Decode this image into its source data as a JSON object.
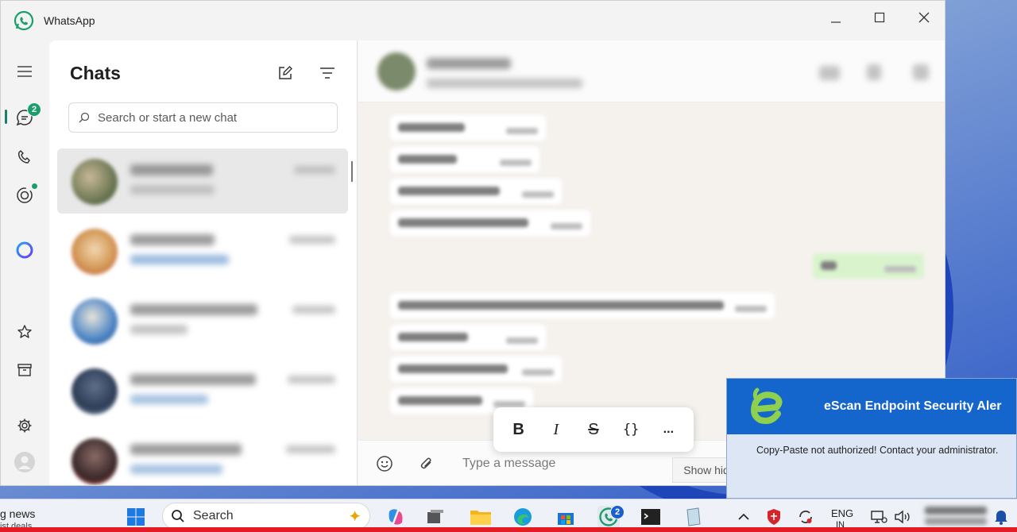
{
  "window": {
    "title": "WhatsApp",
    "controls": [
      "minimize-icon",
      "maximize-icon",
      "close-icon"
    ]
  },
  "rail": {
    "items": [
      {
        "name": "menu",
        "icon": "hamburger-icon"
      },
      {
        "name": "chats",
        "icon": "chat-icon",
        "badge": "2"
      },
      {
        "name": "calls",
        "icon": "phone-icon"
      },
      {
        "name": "status",
        "icon": "status-icon"
      },
      {
        "name": "meta-ai",
        "icon": "meta-ai-icon"
      },
      {
        "name": "starred",
        "icon": "star-icon"
      },
      {
        "name": "archived",
        "icon": "archive-icon"
      },
      {
        "name": "settings",
        "icon": "gear-icon"
      },
      {
        "name": "profile",
        "icon": "avatar-icon"
      }
    ]
  },
  "chats": {
    "heading": "Chats",
    "search_placeholder": "Search or start a new chat",
    "rows_blurred": true
  },
  "conversation": {
    "header_blurred": true,
    "compose_placeholder": "Type a message",
    "format_toolbar": [
      "B",
      "I",
      "S",
      "{}",
      "..."
    ]
  },
  "tooltip": {
    "text": "Show hidden icons"
  },
  "escan_alert": {
    "title": "eScan Endpoint Security Aler",
    "message": "Copy-Paste not authorized! Contact your administrator."
  },
  "taskbar": {
    "news_label": "g news",
    "news_sub": "ist deals",
    "search_label": "Search",
    "whatsapp_badge": "2",
    "language_top": "ENG",
    "language_bottom": "IN"
  },
  "colors": {
    "whatsapp_green": "#1a9f6a",
    "escan_blue": "#1566cc",
    "alert_red": "#e31b23"
  }
}
